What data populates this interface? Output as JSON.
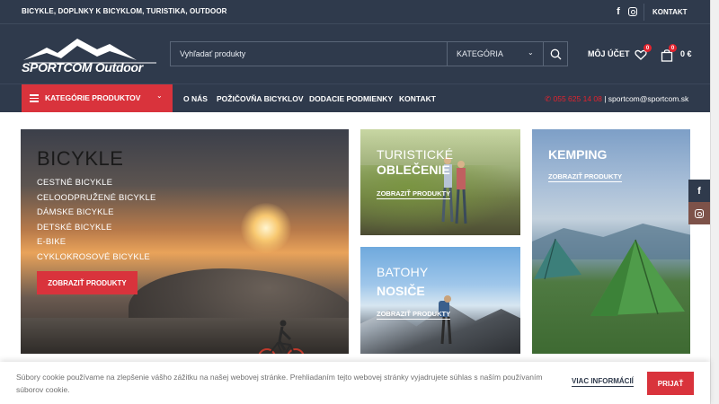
{
  "topbar": {
    "tagline": "BICYKLE, DOPLNKY K BICYKLOM, TURISTIKA, OUTDOOR",
    "facebook_icon": "facebook-icon",
    "instagram_icon": "instagram-icon",
    "contact_label": "KONTAKT"
  },
  "header": {
    "logo_text": "SPORTCOM Outdoor",
    "search": {
      "placeholder": "Vyhľadať produkty",
      "category_label": "KATEGÓRIA"
    },
    "account_label": "MÔJ ÚČET",
    "wishlist_count": "0",
    "cart_count": "0",
    "cart_total": "0 €"
  },
  "nav": {
    "categories_label": "KATEGÓRIE PRODUKTOV",
    "items": [
      {
        "label": "O NÁS"
      },
      {
        "label": "POŽIČOVŇA BICYKLOV"
      },
      {
        "label": "DODACIE PODMIENKY"
      },
      {
        "label": "KONTAKT"
      }
    ],
    "phone": "055 625 14 08",
    "separator": " | ",
    "email": "sportcom@sportcom.sk"
  },
  "tiles": {
    "bicycles": {
      "title": "BICYKLE",
      "links": [
        "CESTNÉ BICYKLE",
        "CELOODPRUŽENÉ BICYKLE",
        "DÁMSKE BICYKLE",
        "DETSKÉ BICYKLE",
        "E-BIKE",
        "CYKLOKROSOVÉ BICYKLE"
      ],
      "cta": "ZOBRAZIŤ PRODUKTY"
    },
    "clothing": {
      "line1": "TURISTICKÉ",
      "line2": "OBLEČENIE",
      "link": "ZOBRAZIŤ PRODUKTY"
    },
    "backpacks": {
      "line1": "BATOHY",
      "line2": "NOSIČE",
      "link": "ZOBRAZIŤ PRODUKTY"
    },
    "camping": {
      "title": "KEMPING",
      "link": "ZOBRAZIŤ PRODUKTY"
    }
  },
  "cookie": {
    "text": "Súbory cookie používame na zlepšenie vášho zážitku na našej webovej stránke. Prehliadaním tejto webovej stránky vyjadrujete súhlas s naším používaním súborov cookie.",
    "more_label": "VIAC INFORMÁCIÍ",
    "accept_label": "PRIJAŤ"
  },
  "colors": {
    "header_bg": "#2f3a4c",
    "accent_red": "#d9333c"
  }
}
